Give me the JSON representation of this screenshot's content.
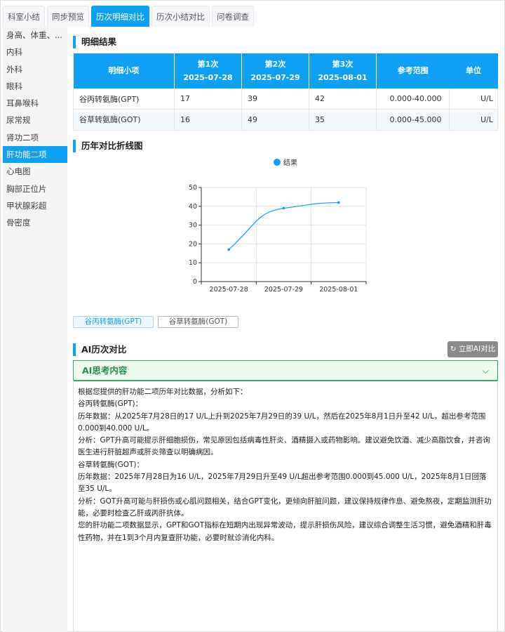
{
  "tabs": [
    "科室小结",
    "同步预览",
    "历次明细对比",
    "历次小结对比",
    "问卷调查"
  ],
  "active_tab": 2,
  "sidebar": [
    "身高、体重、...",
    "内科",
    "外科",
    "眼科",
    "耳鼻喉科",
    "尿常规",
    "肾功二项",
    "肝功能二项",
    "心电图",
    "胸部正位片",
    "甲状腺彩超",
    "骨密度"
  ],
  "active_sidebar": 7,
  "detail": {
    "title": "明细结果",
    "headers": {
      "item": "明细小项",
      "c1": "第1次",
      "d1": "2025-07-28",
      "c2": "第2次",
      "d2": "2025-07-29",
      "c3": "第3次",
      "d3": "2025-08-01",
      "range": "参考范围",
      "unit": "单位"
    },
    "rows": [
      {
        "name": "谷丙转氨酶(GPT)",
        "v1": "17",
        "v2": "39",
        "v3": "42",
        "range": "0.000-40.000",
        "unit": "U/L"
      },
      {
        "name": "谷草转氨酶(GOT)",
        "v1": "16",
        "v2": "49",
        "v3": "35",
        "range": "0.000-45.000",
        "unit": "U/L"
      }
    ]
  },
  "chart_title": "历年对比折线图",
  "chart_data": {
    "type": "line",
    "categories": [
      "2025-07-28",
      "2025-07-29",
      "2025-08-01"
    ],
    "series": [
      {
        "name": "结果",
        "values": [
          17,
          39,
          42
        ]
      }
    ],
    "ylim": [
      0,
      50
    ],
    "yticks": [
      0,
      10,
      20,
      30,
      40,
      50
    ],
    "legend": "top-center",
    "grid": true,
    "color": "#0ea0f5"
  },
  "switch": [
    "谷丙转氨酶(GPT)",
    "谷草转氨酶(GOT)"
  ],
  "ai": {
    "title": "AI历次对比",
    "button": "↻ 立即AI对比",
    "think_label": "AI思考内容",
    "chevron": "⌵",
    "lines": [
      "根据您提供的肝功能二项历年对比数据，分析如下：",
      "谷丙转氨酶(GPT)：",
      "历年数据：从2025年7月28日的17 U/L上升到2025年7月29日的39 U/L，然后在2025年8月1日升至42 U/L，超出参考范围0.000到40.000 U/L。",
      "分析：GPT升高可能提示肝细胞损伤，常见原因包括病毒性肝炎、酒精摄入或药物影响。建议避免饮酒、减少高脂饮食，并咨询医生进行肝脏超声或肝炎筛查以明确病因。",
      "谷草转氨酶(GOT)：",
      "历年数据：2025年7月28日为16 U/L，2025年7月29日升至49 U/L超出参考范围0.000到45.000 U/L，2025年8月1日回落至35 U/L。",
      "分析：GOT升高可能与肝损伤或心肌问题相关，结合GPT变化，更倾向肝脏问题，建议保持规律作息、避免熬夜，定期监测肝功能，必要时检查乙肝或丙肝抗体。",
      "您的肝功能二项数据显示，GPT和GOT指标在短期内出现异常波动，提示肝损伤风险，建议综合调整生活习惯，避免酒精和肝毒性药物，并在1到3个月内复查肝功能，必要时就诊消化内科。"
    ]
  }
}
